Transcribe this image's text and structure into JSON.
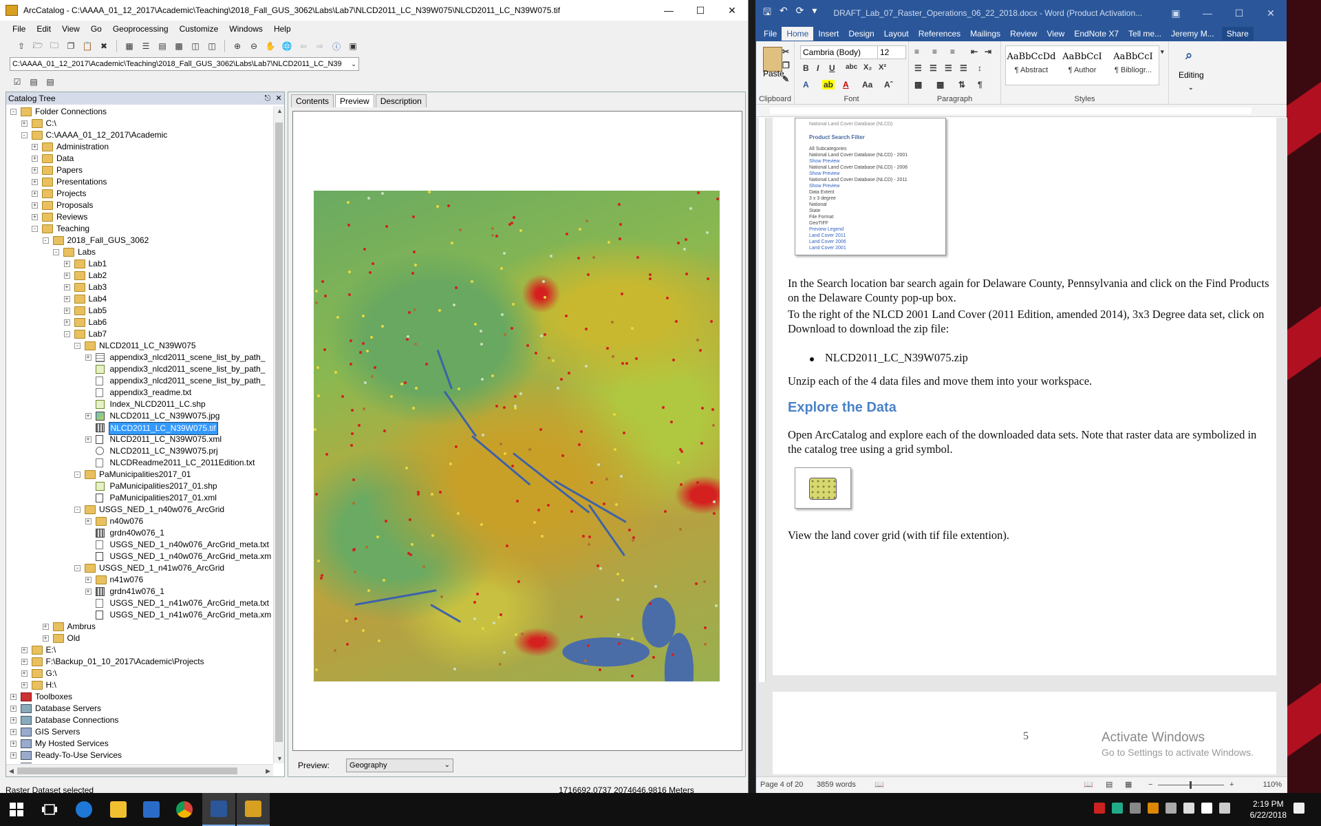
{
  "arccatalog": {
    "title": "ArcCatalog - C:\\AAAA_01_12_2017\\Academic\\Teaching\\2018_Fall_GUS_3062\\Labs\\Lab7\\NLCD2011_LC_N39W075\\NLCD2011_LC_N39W075.tif",
    "menu": [
      "File",
      "Edit",
      "View",
      "Go",
      "Geoprocessing",
      "Customize",
      "Windows",
      "Help"
    ],
    "location": "C:\\AAAA_01_12_2017\\Academic\\Teaching\\2018_Fall_GUS_3062\\Labs\\Lab7\\NLCD2011_LC_N39",
    "tree_header": "Catalog Tree",
    "tree": [
      {
        "label": "Folder Connections",
        "depth": 0,
        "exp": "-",
        "icon": "conn"
      },
      {
        "label": "C:\\",
        "depth": 1,
        "exp": "+",
        "icon": "folder"
      },
      {
        "label": "C:\\AAAA_01_12_2017\\Academic",
        "depth": 1,
        "exp": "-",
        "icon": "folder"
      },
      {
        "label": "Administration",
        "depth": 2,
        "exp": "+",
        "icon": "folder"
      },
      {
        "label": "Data",
        "depth": 2,
        "exp": "+",
        "icon": "folder"
      },
      {
        "label": "Papers",
        "depth": 2,
        "exp": "+",
        "icon": "folder"
      },
      {
        "label": "Presentations",
        "depth": 2,
        "exp": "+",
        "icon": "folder"
      },
      {
        "label": "Projects",
        "depth": 2,
        "exp": "+",
        "icon": "folder"
      },
      {
        "label": "Proposals",
        "depth": 2,
        "exp": "+",
        "icon": "folder"
      },
      {
        "label": "Reviews",
        "depth": 2,
        "exp": "+",
        "icon": "folder"
      },
      {
        "label": "Teaching",
        "depth": 2,
        "exp": "-",
        "icon": "folder"
      },
      {
        "label": "2018_Fall_GUS_3062",
        "depth": 3,
        "exp": "-",
        "icon": "folder"
      },
      {
        "label": "Labs",
        "depth": 4,
        "exp": "-",
        "icon": "folder"
      },
      {
        "label": "Lab1",
        "depth": 5,
        "exp": "+",
        "icon": "folder"
      },
      {
        "label": "Lab2",
        "depth": 5,
        "exp": "+",
        "icon": "folder"
      },
      {
        "label": "Lab3",
        "depth": 5,
        "exp": "+",
        "icon": "folder"
      },
      {
        "label": "Lab4",
        "depth": 5,
        "exp": "+",
        "icon": "folder"
      },
      {
        "label": "Lab5",
        "depth": 5,
        "exp": "+",
        "icon": "folder"
      },
      {
        "label": "Lab6",
        "depth": 5,
        "exp": "+",
        "icon": "folder"
      },
      {
        "label": "Lab7",
        "depth": 5,
        "exp": "-",
        "icon": "folder"
      },
      {
        "label": "NLCD2011_LC_N39W075",
        "depth": 6,
        "exp": "-",
        "icon": "folder"
      },
      {
        "label": "appendix3_nlcd2011_scene_list_by_path_",
        "depth": 7,
        "exp": "+",
        "icon": "table"
      },
      {
        "label": "appendix3_nlcd2011_scene_list_by_path_",
        "depth": 7,
        "exp": "",
        "icon": "shp"
      },
      {
        "label": "appendix3_nlcd2011_scene_list_by_path_",
        "depth": 7,
        "exp": "",
        "icon": "doc"
      },
      {
        "label": "appendix3_readme.txt",
        "depth": 7,
        "exp": "",
        "icon": "doc"
      },
      {
        "label": "Index_NLCD2011_LC.shp",
        "depth": 7,
        "exp": "",
        "icon": "shp"
      },
      {
        "label": "NLCD2011_LC_N39W075.jpg",
        "depth": 7,
        "exp": "+",
        "icon": "rastercol"
      },
      {
        "label": "NLCD2011_LC_N39W075.tif",
        "depth": 7,
        "exp": "",
        "icon": "raster",
        "selected": true
      },
      {
        "label": "NLCD2011_LC_N39W075.xml",
        "depth": 7,
        "exp": "+",
        "icon": "xml"
      },
      {
        "label": "NLCD2011_LC_N39W075.prj",
        "depth": 7,
        "exp": "",
        "icon": "prj"
      },
      {
        "label": "NLCDReadme2011_LC_2011Edition.txt",
        "depth": 7,
        "exp": "",
        "icon": "doc"
      },
      {
        "label": "PaMunicipalities2017_01",
        "depth": 6,
        "exp": "-",
        "icon": "folder"
      },
      {
        "label": "PaMunicipalities2017_01.shp",
        "depth": 7,
        "exp": "",
        "icon": "shp"
      },
      {
        "label": "PaMunicipalities2017_01.xml",
        "depth": 7,
        "exp": "",
        "icon": "xml"
      },
      {
        "label": "USGS_NED_1_n40w076_ArcGrid",
        "depth": 6,
        "exp": "-",
        "icon": "folder"
      },
      {
        "label": "n40w076",
        "depth": 7,
        "exp": "+",
        "icon": "folder"
      },
      {
        "label": "grdn40w076_1",
        "depth": 7,
        "exp": "",
        "icon": "raster"
      },
      {
        "label": "USGS_NED_1_n40w076_ArcGrid_meta.txt",
        "depth": 7,
        "exp": "",
        "icon": "doc"
      },
      {
        "label": "USGS_NED_1_n40w076_ArcGrid_meta.xm",
        "depth": 7,
        "exp": "",
        "icon": "xml"
      },
      {
        "label": "USGS_NED_1_n41w076_ArcGrid",
        "depth": 6,
        "exp": "-",
        "icon": "folder"
      },
      {
        "label": "n41w076",
        "depth": 7,
        "exp": "+",
        "icon": "folder"
      },
      {
        "label": "grdn41w076_1",
        "depth": 7,
        "exp": "+",
        "icon": "raster"
      },
      {
        "label": "USGS_NED_1_n41w076_ArcGrid_meta.txt",
        "depth": 7,
        "exp": "",
        "icon": "doc"
      },
      {
        "label": "USGS_NED_1_n41w076_ArcGrid_meta.xm",
        "depth": 7,
        "exp": "",
        "icon": "xml"
      },
      {
        "label": "Ambrus",
        "depth": 3,
        "exp": "+",
        "icon": "folder"
      },
      {
        "label": "Old",
        "depth": 3,
        "exp": "+",
        "icon": "folder"
      },
      {
        "label": "E:\\",
        "depth": 1,
        "exp": "+",
        "icon": "folder"
      },
      {
        "label": "F:\\Backup_01_10_2017\\Academic\\Projects",
        "depth": 1,
        "exp": "+",
        "icon": "folder"
      },
      {
        "label": "G:\\",
        "depth": 1,
        "exp": "+",
        "icon": "folder"
      },
      {
        "label": "H:\\",
        "depth": 1,
        "exp": "+",
        "icon": "folder"
      },
      {
        "label": "Toolboxes",
        "depth": 0,
        "exp": "+",
        "icon": "toolbox"
      },
      {
        "label": "Database Servers",
        "depth": 0,
        "exp": "+",
        "icon": "db"
      },
      {
        "label": "Database Connections",
        "depth": 0,
        "exp": "+",
        "icon": "db"
      },
      {
        "label": "GIS Servers",
        "depth": 0,
        "exp": "+",
        "icon": "gis"
      },
      {
        "label": "My Hosted Services",
        "depth": 0,
        "exp": "+",
        "icon": "gis"
      },
      {
        "label": "Ready-To-Use Services",
        "depth": 0,
        "exp": "+",
        "icon": "gis"
      },
      {
        "label": "Business Analyst Repository",
        "depth": 0,
        "exp": "+",
        "icon": "db"
      }
    ],
    "tabs": [
      "Contents",
      "Preview",
      "Description"
    ],
    "preview_label": "Preview:",
    "preview_value": "Geography",
    "status_left": "Raster Dataset selected",
    "status_coords": "1716692.0737  2074646.9816 Meters"
  },
  "word": {
    "title": "DRAFT_Lab_07_Raster_Operations_06_22_2018.docx - Word (Product Activation...",
    "tabs": [
      "File",
      "Home",
      "Insert",
      "Design",
      "Layout",
      "References",
      "Mailings",
      "Review",
      "View",
      "EndNote X7",
      "Tell me...",
      "Jeremy M...",
      "Share"
    ],
    "font": "Cambria (Body)",
    "size": "12",
    "styles": [
      {
        "preview": "AaBbCcDd",
        "name": "¶ Abstract"
      },
      {
        "preview": "AaBbCcI",
        "name": "¶ Author"
      },
      {
        "preview": "AaBbCcI",
        "name": "¶ Bibliogr..."
      }
    ],
    "groups": [
      "Clipboard",
      "Font",
      "Paragraph",
      "Styles"
    ],
    "paste": "Paste",
    "editing": "Editing",
    "embedded": {
      "top": "National Land Cover Database (NLCD)",
      "heading": "Product Search Filter",
      "items": [
        "All Subcategories",
        "National Land Cover Database (NLCD) - 2001",
        "Show Preview",
        "National Land Cover Database (NLCD) - 2006",
        "Show Preview",
        "National Land Cover Database (NLCD) - 2011",
        "Show Preview",
        "Data Extent",
        "3 x 3 degree",
        "National",
        "State",
        "File Format",
        "GeoTIFF",
        "Preview Legend",
        "Land Cover 2011",
        "Land Cover 2006",
        "Land Cover 2001"
      ]
    },
    "p1": "In the Search location bar search again for Delaware County, Pennsylvania and click on the Find Products on the Delaware County pop-up box.",
    "p2": "To the right of the NLCD 2001 Land Cover (2011 Edition, amended 2014), 3x3 Degree data set, click on Download to download the zip file:",
    "bullet": "NLCD2011_LC_N39W075.zip",
    "p3": "Unzip each of the 4 data files and move them into your workspace.",
    "heading": "Explore the Data",
    "p4": "Open ArcCatalog and explore each of the downloaded data sets.  Note that raster data are symbolized in the catalog tree using a grid symbol.",
    "p5": "View the land cover grid (with tif file extention).",
    "page_number": "5",
    "activate1": "Activate Windows",
    "activate2": "Go to Settings to activate Windows.",
    "status_page": "Page 4 of 20",
    "status_words": "3859 words",
    "zoom": "110%"
  },
  "taskbar": {
    "time": "2:19 PM",
    "date": "6/22/2018"
  }
}
